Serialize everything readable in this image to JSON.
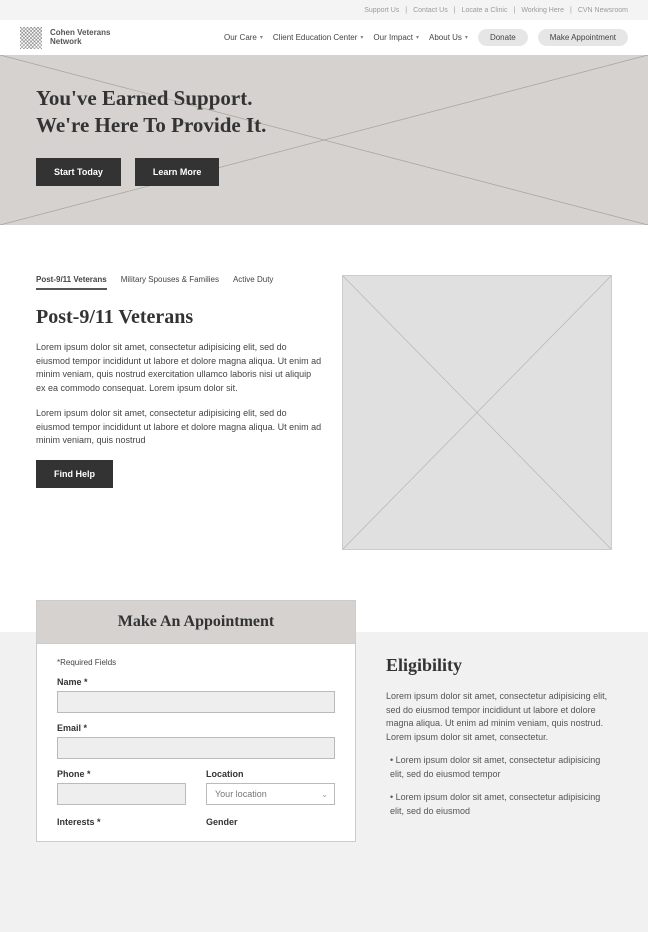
{
  "util": {
    "links": [
      "Support Us",
      "Contact Us",
      "Locate a Clinic",
      "Working Here",
      "CVN Newsroom"
    ]
  },
  "logo": {
    "line1": "Cohen Veterans",
    "line2": "Network"
  },
  "nav": {
    "items": [
      "Our Care",
      "Client Education Center",
      "Our Impact",
      "About Us"
    ],
    "donate": "Donate",
    "appointment": "Make Appointment"
  },
  "hero": {
    "title_line1": "You've Earned Support.",
    "title_line2": "We're Here To Provide It.",
    "start": "Start Today",
    "learn": "Learn More"
  },
  "tabs": {
    "items": [
      "Post-9/11 Veterans",
      "Military Spouses & Families",
      "Active Duty"
    ],
    "heading": "Post-9/11 Veterans",
    "p1": "Lorem ipsum dolor sit amet, consectetur adipisicing elit, sed do eiusmod tempor incididunt ut labore et dolore magna aliqua. Ut enim ad minim veniam, quis nostrud exercitation ullamco laboris nisi ut aliquip ex ea commodo consequat. Lorem ipsum dolor sit.",
    "p2": "Lorem ipsum dolor sit amet, consectetur adipisicing elit, sed do eiusmod tempor incididunt ut labore et dolore magna aliqua. Ut enim ad minim veniam, quis nostrud",
    "find": "Find Help"
  },
  "appt": {
    "title": "Make An Appointment",
    "required": "*Required Fields",
    "name": "Name *",
    "email": "Email *",
    "phone": "Phone *",
    "location": "Location",
    "location_placeholder": "Your location",
    "interests": "Interests *",
    "gender": "Gender"
  },
  "elig": {
    "heading": "Eligibility",
    "p1": "Lorem ipsum dolor sit amet, consectetur adipisicing elit, sed do eiusmod tempor incididunt ut labore et dolore magna aliqua. Ut enim ad minim veniam, quis nostrud. Lorem ipsum dolor sit amet, consectetur.",
    "b1": "• Lorem ipsum dolor sit amet, consectetur adipisicing elit, sed do eiusmod tempor",
    "b2": "• Lorem ipsum dolor sit amet, consectetur adipisicing elit, sed do eiusmod"
  }
}
